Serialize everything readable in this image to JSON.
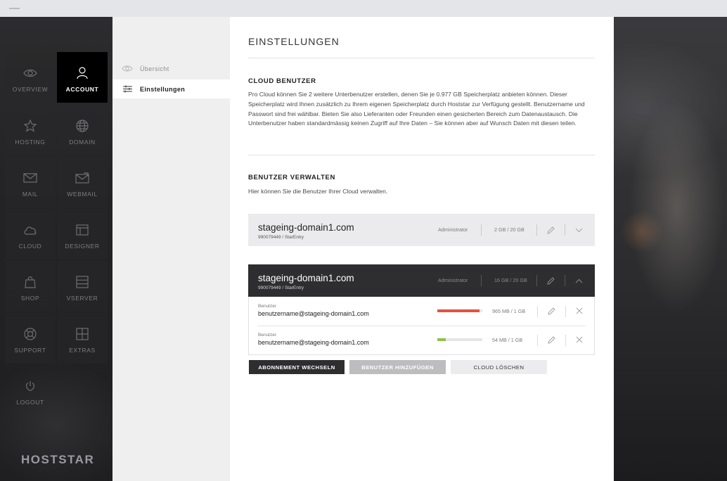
{
  "nav": {
    "brand": "HOSTSTAR",
    "tiles": [
      {
        "label": "OVERVIEW",
        "icon": "eye-icon"
      },
      {
        "label": "ACCOUNT",
        "icon": "user-icon"
      },
      {
        "label": "HOSTING",
        "icon": "star-icon"
      },
      {
        "label": "DOMAIN",
        "icon": "globe-icon"
      },
      {
        "label": "MAIL",
        "icon": "envelope-icon"
      },
      {
        "label": "WEBMAIL",
        "icon": "webmail-icon"
      },
      {
        "label": "CLOUD",
        "icon": "cloud-icon"
      },
      {
        "label": "DESIGNER",
        "icon": "layout-icon"
      },
      {
        "label": "SHOP",
        "icon": "shopping-bag-icon"
      },
      {
        "label": "VSERVER",
        "icon": "server-icon"
      },
      {
        "label": "SUPPORT",
        "icon": "lifebuoy-icon"
      },
      {
        "label": "EXTRAS",
        "icon": "grid-icon"
      },
      {
        "label": "LOGOUT",
        "icon": "power-icon"
      }
    ]
  },
  "submenu": {
    "items": [
      {
        "label": "Übersicht",
        "icon": "eye-icon"
      },
      {
        "label": "Einstellungen",
        "icon": "sliders-icon"
      }
    ]
  },
  "main": {
    "title": "EINSTELLUNGEN",
    "cloud": {
      "heading": "CLOUD BENUTZER",
      "text": "Pro Cloud können Sie 2 weitere Unterbenutzer erstellen, denen Sie je 0.977 GB Speicherplatz anbieten können. Dieser Speicherplatz wird Ihnen zusätzlich zu Ihrem eigenen Speicherplatz durch Hoststar zur Verfügung gestellt. Benutzername und Passwort sind frei wählbar. Bieten Sie also Lieferanten oder Freunden einen gesicherten Bereich zum Datenaustausch. Die Unterbenutzer haben standardmässig keinen Zugriff auf Ihre Daten – Sie können aber auf Wunsch Daten mit diesen teilen."
    },
    "manage": {
      "heading": "BENUTZER VERWALTEN",
      "text": "Hier können Sie die Benutzer Ihrer Cloud verwalten."
    },
    "domains": [
      {
        "name": "stageing-domain1.com",
        "sub": "990079449 / StarEntry",
        "role": "Administrator",
        "size": "2 GB / 20 GB"
      },
      {
        "name": "stageing-domain1.com",
        "sub": "990079449 / StarEntry",
        "role": "Administrator",
        "size": "16 GB / 20 GB"
      }
    ],
    "users": [
      {
        "label": "Benutzer",
        "email": "benutzername@stageing-domain1.com",
        "size": "965 MB / 1 GB",
        "usage": 0.94,
        "bar_color": "#e5533c"
      },
      {
        "label": "Benutzer",
        "email": "benutzername@stageing-domain1.com",
        "size": "54 MB / 1 GB",
        "usage": 0.18,
        "bar_color": "#8bc34a"
      }
    ],
    "buttons": {
      "change_plan": "ABONNEMENT WECHSELN",
      "add_user": "BENUTZER HINZUFÜGEN",
      "delete_cloud": "CLOUD LÖSCHEN"
    }
  }
}
